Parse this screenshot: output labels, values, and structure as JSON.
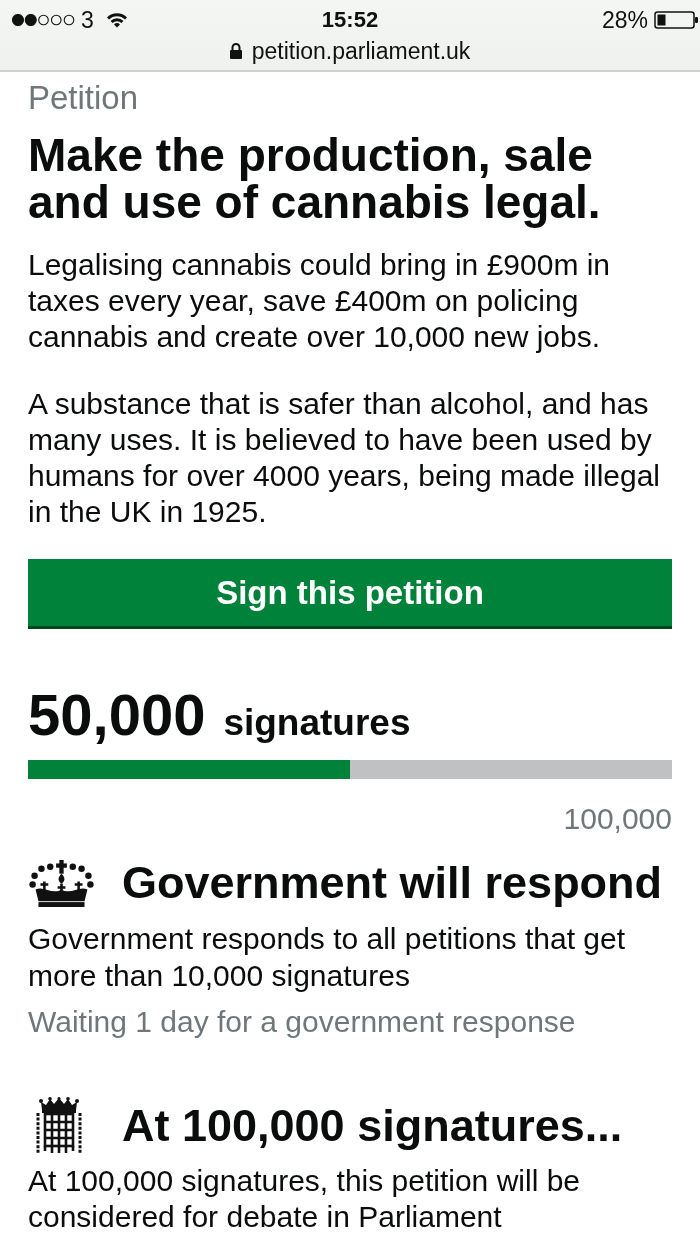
{
  "status_bar": {
    "carrier": "3",
    "time": "15:52",
    "battery": "28%"
  },
  "address_bar": {
    "url": "petition.parliament.uk"
  },
  "petition": {
    "label": "Petition",
    "title": "Make the production, sale and use of cannabis legal.",
    "paragraphs": [
      "Legalising cannabis could bring in £900m in taxes every year, save £400m on policing cannabis and create over 10,000 new jobs.",
      "A substance that is safer than alcohol, and has many uses. It is believed to have been used by humans for over 4000 years, being made illegal in the UK in 1925."
    ],
    "sign_button": "Sign this petition"
  },
  "signatures": {
    "count": "50,000",
    "label": "signatures",
    "level": 0.5,
    "goal": "100,000"
  },
  "thresholds": [
    {
      "kind": "government",
      "heading": "Government will respond",
      "text": "Government responds to all petitions that get more than 10,000 signatures",
      "note": "Waiting 1 day for a government response"
    },
    {
      "kind": "parliament",
      "heading": "At 100,000 signatures...",
      "text": "At 100,000 signatures, this petition will be considered for debate in Parliament"
    }
  ]
}
